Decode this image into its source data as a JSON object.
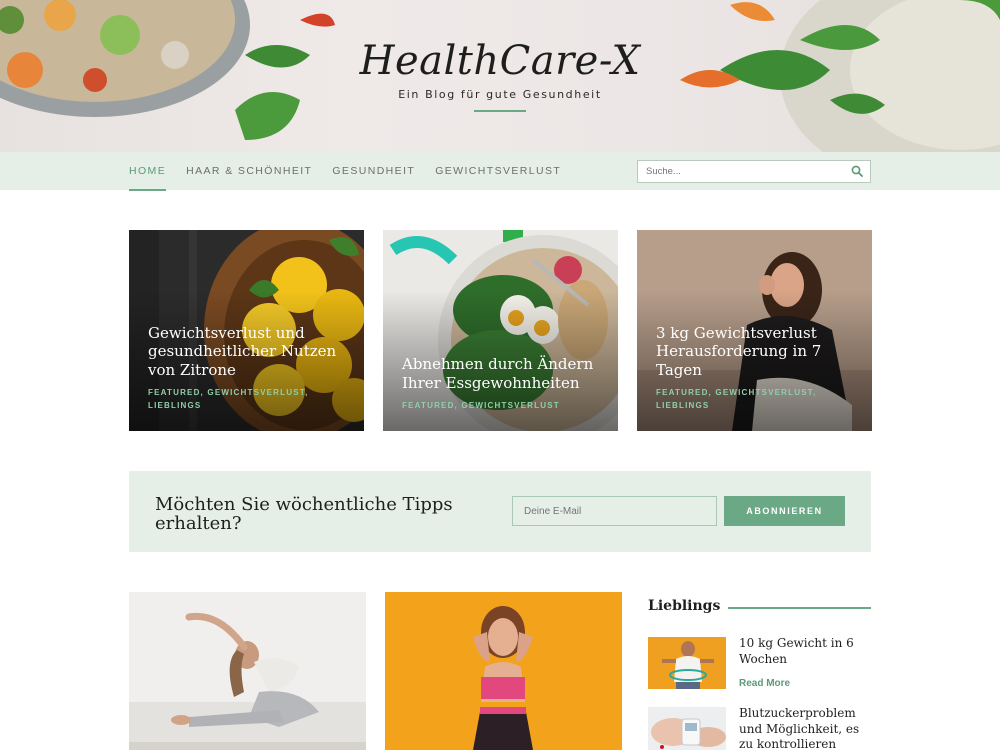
{
  "header": {
    "title": "HealthCare-X",
    "tagline": "Ein Blog für gute Gesundheit"
  },
  "nav": {
    "items": [
      {
        "label": "HOME",
        "active": true
      },
      {
        "label": "HAAR & SCHÖNHEIT",
        "active": false
      },
      {
        "label": "GESUNDHEIT",
        "active": false
      },
      {
        "label": "GEWICHTSVERLUST",
        "active": false
      }
    ],
    "search_placeholder": "Suche..."
  },
  "featured": [
    {
      "title": "Gewichtsverlust und gesundheitlicher Nutzen von Zitrone",
      "categories": "FEATURED, GEWICHTSVERLUST, LIEBLINGS"
    },
    {
      "title": "Abnehmen durch Ändern Ihrer Essgewohnheiten",
      "categories": "FEATURED, GEWICHTSVERLUST"
    },
    {
      "title": "3 kg Gewichtsverlust Herausforderung in 7 Tagen",
      "categories": "FEATURED, GEWICHTSVERLUST, LIEBLINGS"
    }
  ],
  "newsletter": {
    "title": "Möchten Sie wöchentliche Tipps erhalten?",
    "email_placeholder": "Deine E-Mail",
    "button_label": "ABONNIEREN"
  },
  "sidebar": {
    "title": "Lieblings",
    "posts": [
      {
        "title": "10 kg Gewicht in 6 Wochen",
        "more": "Read More"
      },
      {
        "title": "Blutzuckerproblem und Möglichkeit, es zu kontrollieren"
      }
    ]
  },
  "colors": {
    "accent": "#6aa886",
    "nav_background": "#e5efe8",
    "card_category": "#8fcfa9"
  }
}
